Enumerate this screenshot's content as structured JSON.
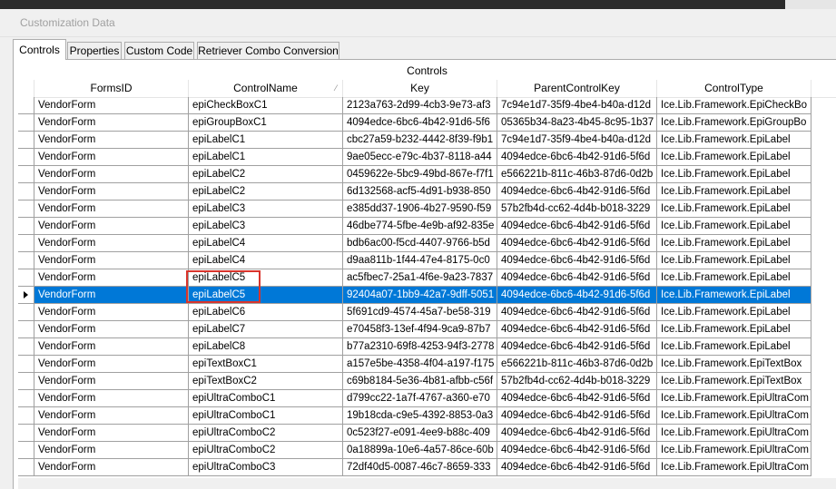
{
  "window": {
    "title": "Customization Data"
  },
  "tabs": [
    {
      "label": "Controls",
      "active": true
    },
    {
      "label": "Properties",
      "active": false
    },
    {
      "label": "Custom Code",
      "active": false
    },
    {
      "label": "Retriever Combo Conversion",
      "active": false
    }
  ],
  "grid": {
    "caption": "Controls",
    "columns": [
      "FormsID",
      "ControlName",
      "Key",
      "ParentControlKey",
      "ControlType"
    ],
    "sorted_column": "ControlName",
    "selected_row": 11,
    "highlighted_cell": {
      "row": 10,
      "column": "ControlName"
    },
    "rows": [
      [
        "VendorForm",
        "epiCheckBoxC1",
        "2123a763-2d99-4cb3-9e73-af3",
        "7c94e1d7-35f9-4be4-b40a-d12d",
        "Ice.Lib.Framework.EpiCheckBo"
      ],
      [
        "VendorForm",
        "epiGroupBoxC1",
        "4094edce-6bc6-4b42-91d6-5f6",
        "05365b34-8a23-4b45-8c95-1b37",
        "Ice.Lib.Framework.EpiGroupBo"
      ],
      [
        "VendorForm",
        "epiLabelC1",
        "cbc27a59-b232-4442-8f39-f9b1",
        "7c94e1d7-35f9-4be4-b40a-d12d",
        "Ice.Lib.Framework.EpiLabel"
      ],
      [
        "VendorForm",
        "epiLabelC1",
        "9ae05ecc-e79c-4b37-8118-a44",
        "4094edce-6bc6-4b42-91d6-5f6d",
        "Ice.Lib.Framework.EpiLabel"
      ],
      [
        "VendorForm",
        "epiLabelC2",
        "0459622e-5bc9-49bd-867e-f7f1",
        "e566221b-811c-46b3-87d6-0d2b",
        "Ice.Lib.Framework.EpiLabel"
      ],
      [
        "VendorForm",
        "epiLabelC2",
        "6d132568-acf5-4d91-b938-850",
        "4094edce-6bc6-4b42-91d6-5f6d",
        "Ice.Lib.Framework.EpiLabel"
      ],
      [
        "VendorForm",
        "epiLabelC3",
        "e385dd37-1906-4b27-9590-f59",
        "57b2fb4d-cc62-4d4b-b018-3229",
        "Ice.Lib.Framework.EpiLabel"
      ],
      [
        "VendorForm",
        "epiLabelC3",
        "46dbe774-5fbe-4e9b-af92-835e",
        "4094edce-6bc6-4b42-91d6-5f6d",
        "Ice.Lib.Framework.EpiLabel"
      ],
      [
        "VendorForm",
        "epiLabelC4",
        "bdb6ac00-f5cd-4407-9766-b5d",
        "4094edce-6bc6-4b42-91d6-5f6d",
        "Ice.Lib.Framework.EpiLabel"
      ],
      [
        "VendorForm",
        "epiLabelC4",
        "d9aa811b-1f44-47e4-8175-0c0",
        "4094edce-6bc6-4b42-91d6-5f6d",
        "Ice.Lib.Framework.EpiLabel"
      ],
      [
        "VendorForm",
        "epiLabelC5",
        "ac5fbec7-25a1-4f6e-9a23-7837",
        "4094edce-6bc6-4b42-91d6-5f6d",
        "Ice.Lib.Framework.EpiLabel"
      ],
      [
        "VendorForm",
        "epiLabelC5",
        "92404a07-1bb9-42a7-9dff-5051",
        "4094edce-6bc6-4b42-91d6-5f6d",
        "Ice.Lib.Framework.EpiLabel"
      ],
      [
        "VendorForm",
        "epiLabelC6",
        "5f691cd9-4574-45a7-be58-319",
        "4094edce-6bc6-4b42-91d6-5f6d",
        "Ice.Lib.Framework.EpiLabel"
      ],
      [
        "VendorForm",
        "epiLabelC7",
        "e70458f3-13ef-4f94-9ca9-87b7",
        "4094edce-6bc6-4b42-91d6-5f6d",
        "Ice.Lib.Framework.EpiLabel"
      ],
      [
        "VendorForm",
        "epiLabelC8",
        "b77a2310-69f8-4253-94f3-2778",
        "4094edce-6bc6-4b42-91d6-5f6d",
        "Ice.Lib.Framework.EpiLabel"
      ],
      [
        "VendorForm",
        "epiTextBoxC1",
        "a157e5be-4358-4f04-a197-f175",
        "e566221b-811c-46b3-87d6-0d2b",
        "Ice.Lib.Framework.EpiTextBox"
      ],
      [
        "VendorForm",
        "epiTextBoxC2",
        "c69b8184-5e36-4b81-afbb-c56f",
        "57b2fb4d-cc62-4d4b-b018-3229",
        "Ice.Lib.Framework.EpiTextBox"
      ],
      [
        "VendorForm",
        "epiUltraComboC1",
        "d799cc22-1a7f-4767-a360-e70",
        "4094edce-6bc6-4b42-91d6-5f6d",
        "Ice.Lib.Framework.EpiUltraCom"
      ],
      [
        "VendorForm",
        "epiUltraComboC1",
        "19b18cda-c9e5-4392-8853-0a3",
        "4094edce-6bc6-4b42-91d6-5f6d",
        "Ice.Lib.Framework.EpiUltraCom"
      ],
      [
        "VendorForm",
        "epiUltraComboC2",
        "0c523f27-e091-4ee9-b88c-409",
        "4094edce-6bc6-4b42-91d6-5f6d",
        "Ice.Lib.Framework.EpiUltraCom"
      ],
      [
        "VendorForm",
        "epiUltraComboC2",
        "0a18899a-10e6-4a57-86ce-60b",
        "4094edce-6bc6-4b42-91d6-5f6d",
        "Ice.Lib.Framework.EpiUltraCom"
      ],
      [
        "VendorForm",
        "epiUltraComboC3",
        "72df40d5-0087-46c7-8659-333",
        "4094edce-6bc6-4b42-91d6-5f6d",
        "Ice.Lib.Framework.EpiUltraCom"
      ]
    ]
  }
}
